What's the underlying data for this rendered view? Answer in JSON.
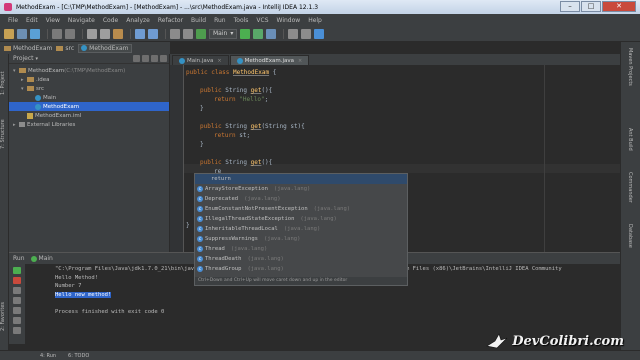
{
  "window": {
    "title": "MethodExam - [C:\\TMP\\MethodExam] - [MethodExam] - ...\\src\\MethodExam.java - IntelliJ IDEA 12.1.3",
    "min": "–",
    "max": "□",
    "close": "✕"
  },
  "menu": [
    "File",
    "Edit",
    "View",
    "Navigate",
    "Code",
    "Analyze",
    "Refactor",
    "Build",
    "Run",
    "Tools",
    "VCS",
    "Window",
    "Help"
  ],
  "toolbar": {
    "run_config": "Main"
  },
  "breadcrumb": [
    "MethodExam",
    "src",
    "MethodExam"
  ],
  "project_panel": {
    "header": "Project",
    "tree": [
      {
        "indent": 0,
        "twisty": "▾",
        "icon": "folder",
        "label": "MethodExam",
        "suffix": " (C:\\TMP\\MethodExam)"
      },
      {
        "indent": 1,
        "twisty": "▸",
        "icon": "folder",
        "label": ".idea",
        "suffix": ""
      },
      {
        "indent": 1,
        "twisty": "▾",
        "icon": "folder",
        "label": "src",
        "suffix": ""
      },
      {
        "indent": 2,
        "twisty": "",
        "icon": "class",
        "label": "Main",
        "suffix": ""
      },
      {
        "indent": 2,
        "twisty": "",
        "icon": "class",
        "label": "MethodExam",
        "suffix": ""
      },
      {
        "indent": 1,
        "twisty": "",
        "icon": "xml",
        "label": "MethodExam.iml",
        "suffix": ""
      },
      {
        "indent": 0,
        "twisty": "▸",
        "icon": "lib",
        "label": "External Libraries",
        "suffix": ""
      }
    ]
  },
  "left_tabs": [
    "1: Project",
    "7: Structure",
    "2: Favorites"
  ],
  "right_tabs": [
    "Maven Projects",
    "Ant Build",
    "Commander",
    "Database"
  ],
  "editor_tabs": [
    {
      "label": "Main.java",
      "active": false
    },
    {
      "label": "MethodExam.java",
      "active": true
    }
  ],
  "code": [
    {
      "kind": "class",
      "kw": "public class ",
      "name": "MethodExam",
      "rest": " {"
    },
    {
      "kind": "blank"
    },
    {
      "kind": "method",
      "kw": "public ",
      "type": "String ",
      "name": "get",
      "rest": "(){"
    },
    {
      "kind": "return",
      "kw": "return ",
      "str": "\"Hello\"",
      "rest": ";"
    },
    {
      "kind": "close",
      "rest": "}"
    },
    {
      "kind": "blank"
    },
    {
      "kind": "method",
      "kw": "public ",
      "type": "String ",
      "name": "get",
      "rest": "(String st){"
    },
    {
      "kind": "return",
      "kw": "return ",
      "str": "",
      "rest": "st;"
    },
    {
      "kind": "close",
      "rest": "}"
    },
    {
      "kind": "blank"
    },
    {
      "kind": "method",
      "kw": "public ",
      "type": "String ",
      "name": "get",
      "rest": "(){"
    },
    {
      "kind": "typing",
      "rest": "re"
    },
    {
      "kind": "blank"
    },
    {
      "kind": "blank"
    },
    {
      "kind": "blank"
    },
    {
      "kind": "blank"
    },
    {
      "kind": "blank"
    },
    {
      "kind": "brace",
      "rest": "}"
    }
  ],
  "autocomplete": {
    "items": [
      {
        "label": "return",
        "pkg": "",
        "keyword": true
      },
      {
        "label": "ArrayStoreException",
        "pkg": "(java.lang)"
      },
      {
        "label": "Deprecated",
        "pkg": "(java.lang)"
      },
      {
        "label": "EnumConstantNotPresentException",
        "pkg": "(java.lang)"
      },
      {
        "label": "IllegalThreadStateException",
        "pkg": "(java.lang)"
      },
      {
        "label": "InheritableThreadLocal",
        "pkg": "(java.lang)"
      },
      {
        "label": "SuppressWarnings",
        "pkg": "(java.lang)"
      },
      {
        "label": "Thread",
        "pkg": "(java.lang)"
      },
      {
        "label": "ThreadDeath",
        "pkg": "(java.lang)"
      },
      {
        "label": "ThreadGroup",
        "pkg": "(java.lang)"
      }
    ],
    "hint": "Ctrl+Down and Ctrl+Up will move caret down and up in the editor"
  },
  "run_panel": {
    "label": "Run",
    "config": "Main",
    "lines": [
      {
        "text": "\"C:\\Program Files\\Java\\jdk1.7.0_21\\bin\\java\" -Didea.launcher.port=7534 \"-Didea.launcher.bin.path=C:\\Program Files (x86)\\JetBrains\\IntelliJ IDEA Community",
        "style": ""
      },
      {
        "text": "Hello Method!",
        "style": ""
      },
      {
        "text": "Number 7",
        "style": ""
      },
      {
        "text": "Hello new method!",
        "style": "hl"
      },
      {
        "text": "",
        "style": ""
      },
      {
        "text": "Process finished with exit code 0",
        "style": ""
      }
    ]
  },
  "statusbar": {
    "left": "4: Run",
    "todo": "6: TODO"
  },
  "watermark": {
    "text": "DevColibri.com"
  }
}
